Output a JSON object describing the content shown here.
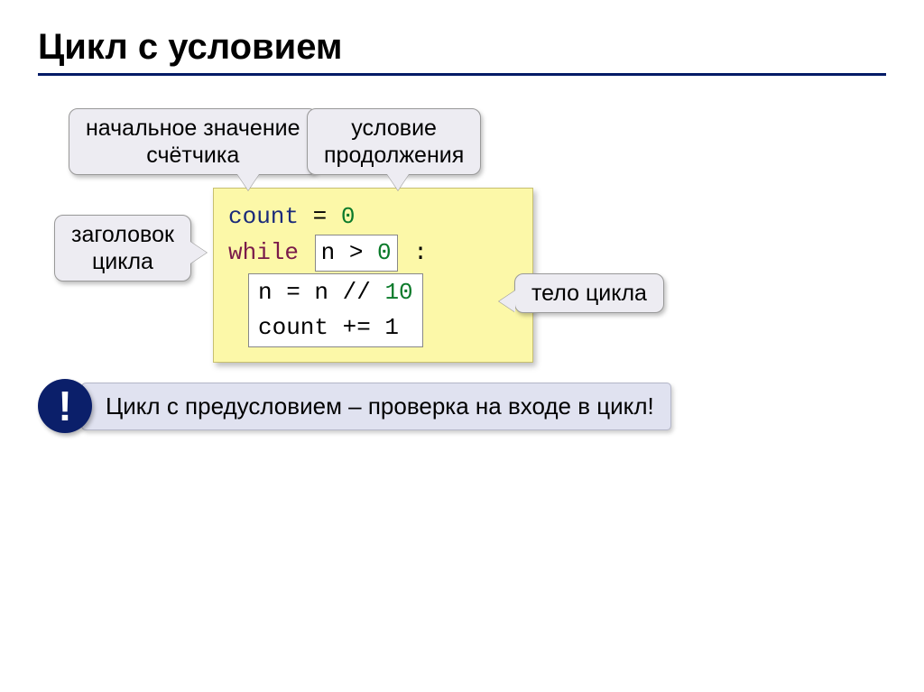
{
  "title": "Цикл с условием",
  "callouts": {
    "initial": "начальное значение\nсчётчика",
    "condition": "условие\nпродолжения",
    "header": "заголовок\nцикла",
    "body": "тело цикла"
  },
  "code": {
    "count_kw": "count",
    "eq": " = ",
    "zero": "0",
    "while_kw": "while",
    "cond_pre": " ",
    "cond_n": "n > ",
    "cond_num": "0",
    "cond_post": " :",
    "body_line1_a": "n = n // ",
    "body_line1_num": "10",
    "body_line2": "count += 1"
  },
  "note": {
    "marker": "!",
    "text": "Цикл с предусловием – проверка на входе в цикл!"
  }
}
